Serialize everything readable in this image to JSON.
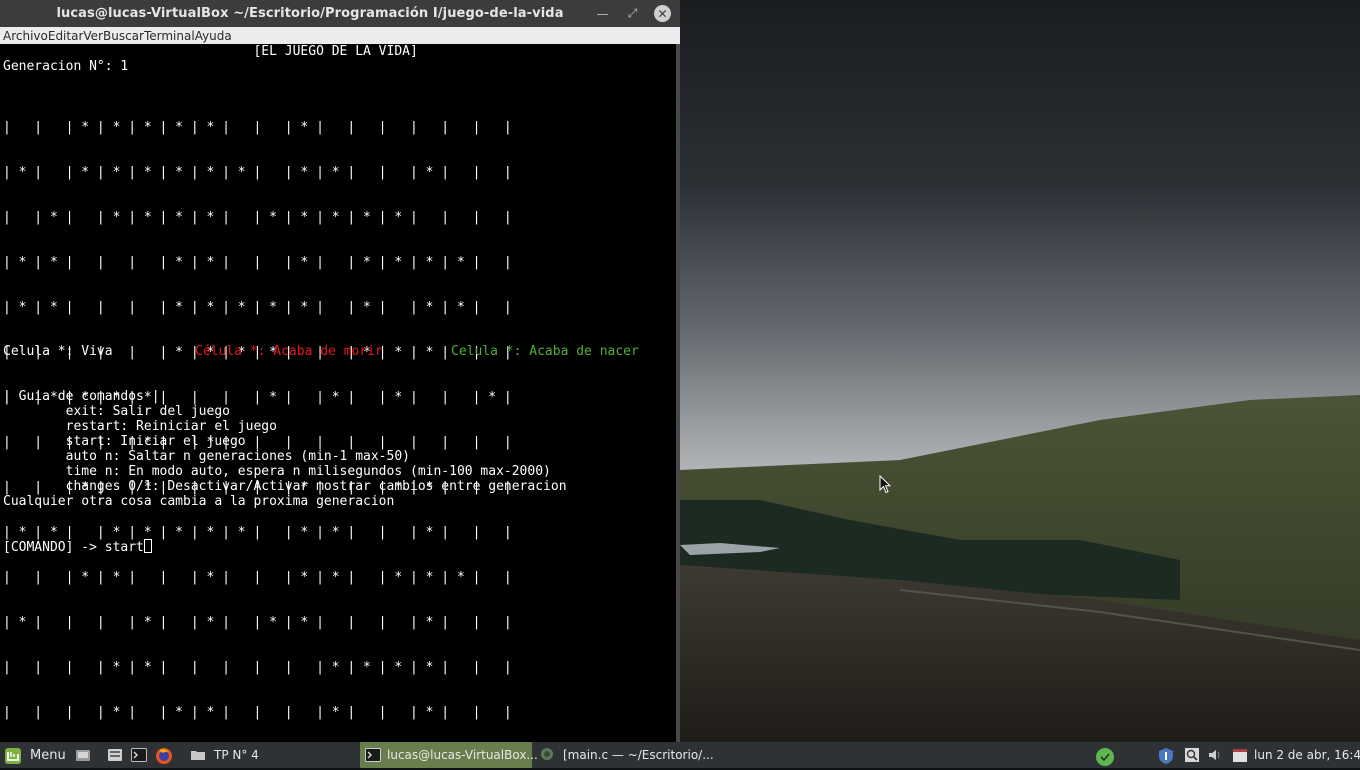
{
  "window": {
    "title": "lucas@lucas-VirtualBox ~/Escritorio/Programación I/juego-de-la-vida",
    "controls": [
      "minimize-icon",
      "maximize-icon",
      "close-icon"
    ]
  },
  "menubar": {
    "items": [
      "Archivo",
      "Editar",
      "Ver",
      "Buscar",
      "Terminal",
      "Ayuda"
    ]
  },
  "terminal": {
    "header": "                                [EL JUEGO DE LA VIDA]",
    "generation_line": "Generacion N°: 1",
    "grid_rows": [
      "|   |   | * | * | * | * | * |   |   | * |   |   |   |   |   |   |",
      "| * |   | * | * | * | * | * | * |   | * | * |   |   | * |   |   |",
      "|   | * |   | * | * | * | * |   | * | * | * | * | * |   |   |   |",
      "| * | * |   |   |   | * | * |   |   | * |   | * | * | * | * |   |",
      "| * | * |   |   |   | * | * | * | * | * |   | * |   | * | * |   |",
      "|   |   |   |   |   | * | * | * | * |   |   | * | * | * |   |   |",
      "|   | * | * | * | * |   |   |   | * |   | * |   | * |   |   | * |",
      "|   |   |   |   | * |   | * |   |   |   |   |   |   |   |   |   |",
      "|   |   | * |   | * |   |   |   |   | * |   |   | * | * |   |   |",
      "| * | * |   | * | * | * | * | * |   | * | * |   |   | * |   |   |",
      "|   |   | * | * |   |   | * |   |   | * | * |   | * | * | * |   |",
      "| * |   |   |   | * |   | * |   | * | * |   |   |   | * |   |   |",
      "|   |   |   | * | * |   |   |   |   |   | * | * | * | * |   |   |",
      "|   |   |   | * |   | * | * |   |   |   | * |   |   | * |   |   |",
      "|   |   |   |   | * | * |   | * | * |   |   |   |   | * | * |   |"
    ],
    "legend": {
      "alive": "Celula *: Viva",
      "died": "Célula *: Acaba de morir",
      "born": "Celula *: Acaba de nacer",
      "alive_color": "#ffffff",
      "died_color": "#e0191c",
      "born_color": "#4fae3a"
    },
    "guide_title": "| Guia de comandos |",
    "guide_lines": [
      "        exit: Salir del juego",
      "        restart: Reiniciar el juego",
      "        start: Iniciar el juego",
      "        auto n: Saltar n generaciones (min-1 max-50)",
      "        time n: En modo auto, espera n milisegundos (min-100 max-2000)",
      "        changes 0/1: Desactivar/Activar mostrar cambios entre generacion"
    ],
    "guide_footer": "Cualquier otra cosa cambia a la proxima generacion",
    "prompt": "[COMANDO] -> ",
    "input_value": "start"
  },
  "taskbar": {
    "menu_label": "Menu",
    "launchers": [
      "files-icon",
      "terminal-icon",
      "firefox-icon"
    ],
    "folder_label": "TP N° 4",
    "tasks": [
      {
        "label": "lucas@lucas-VirtualBox...",
        "icon": "terminal-icon",
        "active": true
      },
      {
        "label": "[main.c — ~/Escritorio/...",
        "icon": "editor-icon",
        "active": false
      }
    ],
    "tray": [
      "update-icon",
      "shield-icon",
      "search-icon",
      "volume-icon",
      "calendar-icon"
    ],
    "clock": "lun  2 de abr, 16:41",
    "accent": "#687e4c"
  }
}
